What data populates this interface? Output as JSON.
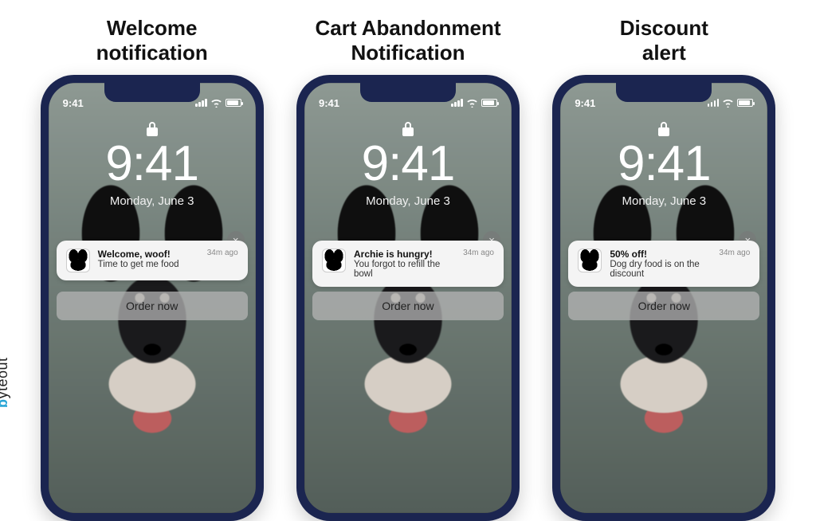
{
  "headings": [
    "Welcome\nnotification",
    "Cart Abandonment\nNotification",
    "Discount\nalert"
  ],
  "lockscreen": {
    "status_time": "9:41",
    "big_time": "9:41",
    "date": "Monday, June 3"
  },
  "notifications": [
    {
      "title": "Welcome, woof!",
      "message": "Time to get me food",
      "time": "34m ago",
      "cta": "Order now"
    },
    {
      "title": "Archie is hungry!",
      "message": "You forgot to refill the bowl",
      "time": "34m ago",
      "cta": "Order now"
    },
    {
      "title": "50% off!",
      "message": "Dog dry food is on the  discount",
      "time": "34m ago",
      "cta": "Order now"
    }
  ],
  "brand": "byteout",
  "icons": {
    "lock": "lock-icon",
    "close": "×"
  }
}
